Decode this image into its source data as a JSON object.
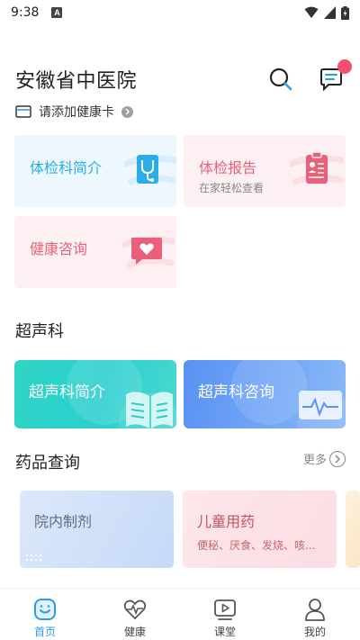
{
  "status_bar": {
    "time": "9:38",
    "notification_letter": "A"
  },
  "header": {
    "hospital_name": "安徽省中医院"
  },
  "health_card": {
    "label": "请添加健康卡"
  },
  "quick_tiles": [
    {
      "title": "体检科简介",
      "subtitle": "",
      "color": "#29aee8",
      "bg": "#eef7fd"
    },
    {
      "title": "体检报告",
      "subtitle": "在家轻松查看",
      "color": "#e8607a",
      "bg": "#fdf0f3"
    },
    {
      "title": "健康咨询",
      "subtitle": "",
      "color": "#e8607a",
      "bg": "#fdf0f3"
    }
  ],
  "ultrasound": {
    "section_title": "超声科",
    "cards": [
      {
        "title": "超声科简介",
        "color": "#2bd1c4"
      },
      {
        "title": "超声科咨询",
        "color": "#5a96f2"
      }
    ]
  },
  "drugs": {
    "section_title": "药品查询",
    "more_label": "更多",
    "cards": [
      {
        "title": "院内制剂",
        "subtitle": "",
        "color": "#5f6b85"
      },
      {
        "title": "儿童用药",
        "subtitle": "便秘、厌食、发烧、咳...",
        "color": "#c7505f"
      }
    ]
  },
  "bottom_nav": {
    "items": [
      {
        "label": "首页",
        "icon": "home-smile-icon",
        "active": true
      },
      {
        "label": "健康",
        "icon": "heart-pulse-icon",
        "active": false
      },
      {
        "label": "课堂",
        "icon": "video-class-icon",
        "active": false
      },
      {
        "label": "我的",
        "icon": "user-profile-icon",
        "active": false
      }
    ],
    "active_color": "#2b9be8"
  }
}
